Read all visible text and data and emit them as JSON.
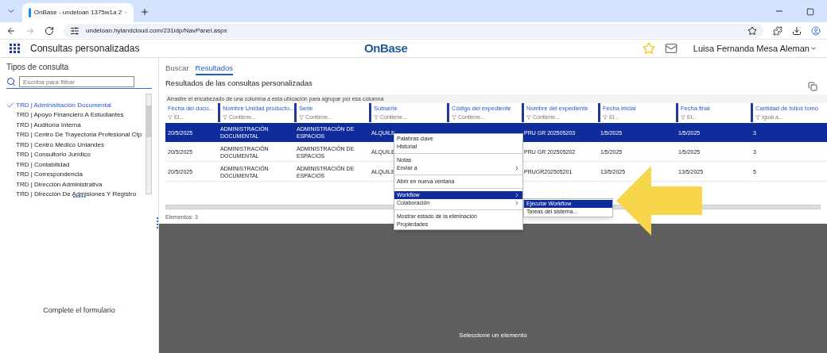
{
  "browser": {
    "tab_title": "OnBase - undeloan 1375w1a 2",
    "url": "undeloan.hylandcloud.com/231idp/NavPanel.aspx"
  },
  "app": {
    "title": "Consultas personalizadas",
    "logo": "OnBase",
    "user": "Luisa Fernanda Mesa Aleman"
  },
  "sidebar": {
    "title": "Tipos de consulta",
    "search": {
      "placeholder": "Escriba para filtrar"
    },
    "items": [
      {
        "label": "TRD | Administración Documental",
        "selected": true
      },
      {
        "label": "TRD | Apoyo Financiero A Estudiantes",
        "selected": false
      },
      {
        "label": "TRD | Auditoría Interna",
        "selected": false
      },
      {
        "label": "TRD | Centro De Trayectoria Profesional Ctp",
        "selected": false
      },
      {
        "label": "TRD | Centro Médico Uniandes",
        "selected": false
      },
      {
        "label": "TRD | Consultorio Jurídico",
        "selected": false
      },
      {
        "label": "TRD | Contabilidad",
        "selected": false
      },
      {
        "label": "TRD | Correspondencia",
        "selected": false
      },
      {
        "label": "TRD | Dirección Administrativa",
        "selected": false
      },
      {
        "label": "TRD | Dirección De Admisiones Y Registro",
        "selected": false
      }
    ],
    "footer": "Complete el formulario"
  },
  "tabs": [
    {
      "label": "Buscar",
      "selected": false
    },
    {
      "label": "Resultados",
      "selected": true
    }
  ],
  "results": {
    "title": "Resultados de las consultas personalizadas",
    "group_hint": "Arrastre el encabezado de una columna a esta ubicación para agrupar por esa columna",
    "columns": [
      {
        "label": "Fecha del docu...",
        "filter": "El..."
      },
      {
        "label": "Nombre Unidad producto...",
        "filter": "Contiene..."
      },
      {
        "label": "Serie",
        "filter": "Contiene..."
      },
      {
        "label": "Subserie",
        "filter": "Contiene..."
      },
      {
        "label": "Código del expediente",
        "filter": "Contiene..."
      },
      {
        "label": "Nombre del expediente",
        "filter": "Contiene..."
      },
      {
        "label": "Fecha inicial",
        "filter": "El..."
      },
      {
        "label": "Fecha final",
        "filter": "El..."
      },
      {
        "label": "Cantidad de folios tomo",
        "filter": "Igual a..."
      }
    ],
    "rows": [
      {
        "selected": true,
        "cells": [
          "20/5/2025",
          "ADMINISTRACIÓN DOCUMENTAL",
          "ADMINISTRACIÓN DE ESPACIOS",
          "ALQUILE",
          "",
          "PRU GR 202505203",
          "1/5/2025",
          "1/5/2025",
          "3"
        ]
      },
      {
        "selected": false,
        "cells": [
          "20/5/2025",
          "ADMINISTRACIÓN DOCUMENTAL",
          "ADMINISTRACIÓN DE ESPACIOS",
          "ALQUILE",
          "",
          "PRU GR 202505202",
          "1/5/2025",
          "1/5/2025",
          "3"
        ]
      },
      {
        "selected": false,
        "cells": [
          "20/5/2025",
          "ADMINISTRACIÓN DOCUMENTAL",
          "ADMINISTRACIÓN DE ESPACIOS",
          "ALQUILE",
          "",
          "PRUGR202505201",
          "13/5/2025",
          "13/5/2025",
          "5"
        ]
      }
    ],
    "count": "Elementos: 3"
  },
  "context_menu": [
    {
      "kind": "item",
      "label": "Palabras clave",
      "submenu": false,
      "selected": false
    },
    {
      "kind": "item",
      "label": "Historial",
      "submenu": false,
      "selected": false
    },
    {
      "kind": "separator"
    },
    {
      "kind": "item",
      "label": "Notas",
      "submenu": false,
      "selected": false
    },
    {
      "kind": "item",
      "label": "Enviar a",
      "submenu": true,
      "selected": false
    },
    {
      "kind": "separator"
    },
    {
      "kind": "item",
      "label": "Abrir en nueva ventana",
      "submenu": false,
      "selected": false
    },
    {
      "kind": "separator"
    },
    {
      "kind": "item",
      "label": "Workflow",
      "submenu": true,
      "selected": true
    },
    {
      "kind": "item",
      "label": "Colaboración",
      "submenu": true,
      "selected": false
    },
    {
      "kind": "separator"
    },
    {
      "kind": "item",
      "label": "Mostrar estado de la eliminación",
      "submenu": false,
      "selected": false
    },
    {
      "kind": "item",
      "label": "Propiedades",
      "submenu": false,
      "selected": false
    }
  ],
  "submenu": [
    {
      "label": "Ejecutar Workflow",
      "selected": true
    },
    {
      "label": "Tareas del sistema...",
      "selected": false
    }
  ],
  "viewer": {
    "message": "Seleccione un elemento"
  }
}
